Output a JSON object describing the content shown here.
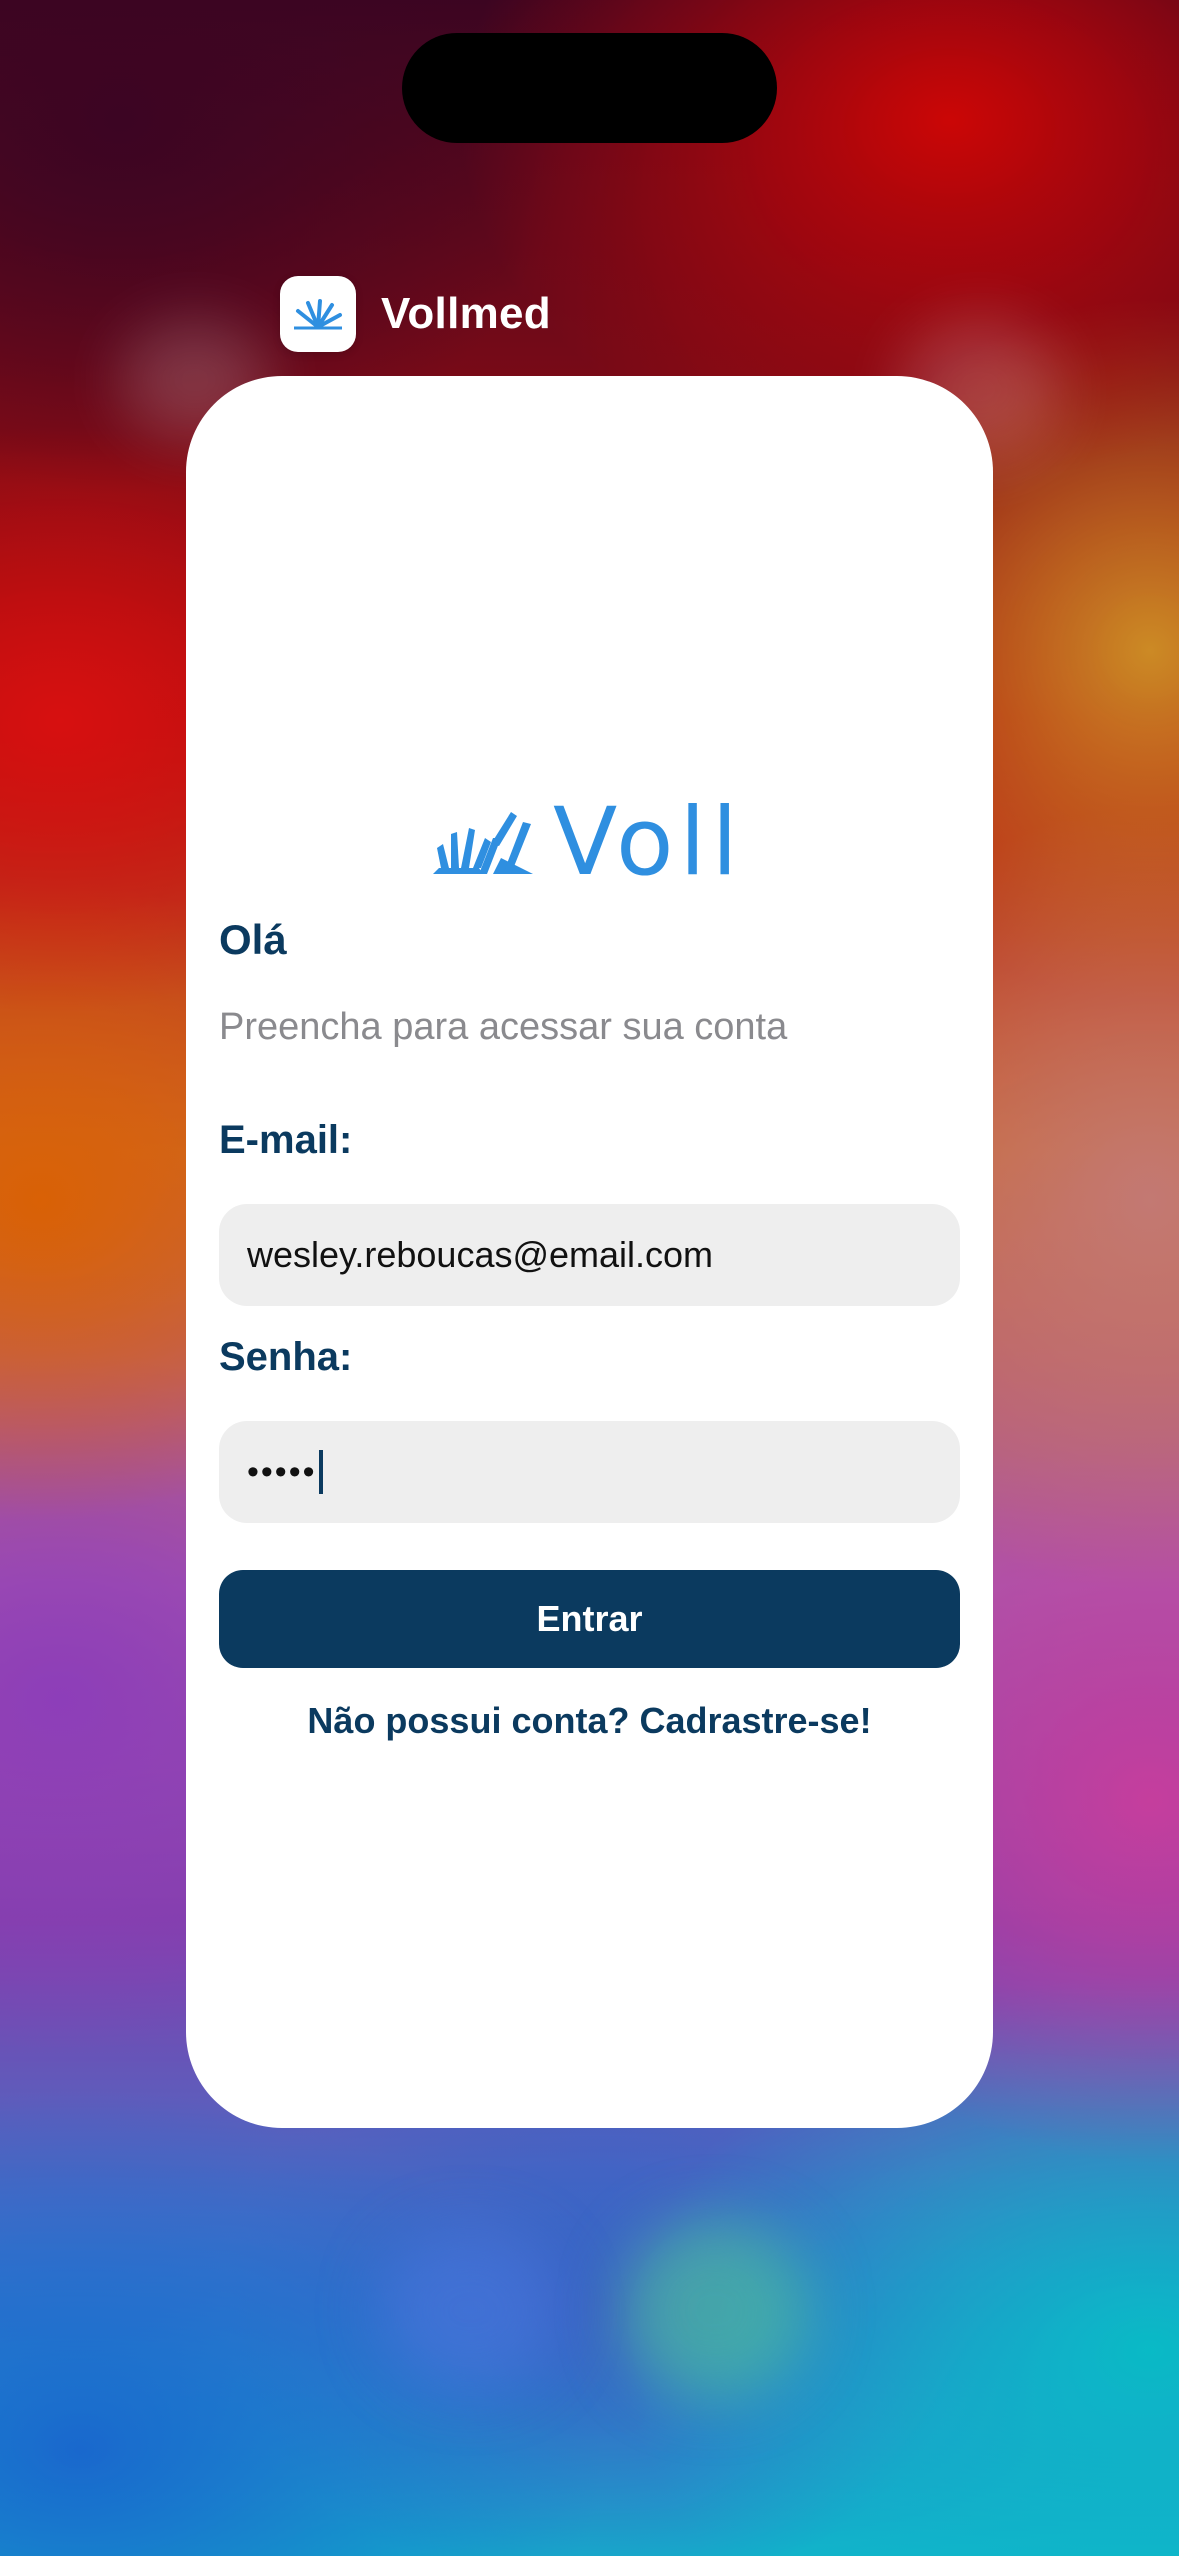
{
  "app": {
    "name": "Vollmed"
  },
  "logo": {
    "text": "Voll",
    "color": "#2f8fe0"
  },
  "login": {
    "greeting": "Olá",
    "subtitle": "Preencha para acessar sua conta",
    "email_label": "E-mail:",
    "email_value": "wesley.reboucas@email.com",
    "password_label": "Senha:",
    "password_value": "•••••",
    "submit_label": "Entrar",
    "signup_link": "Não possui conta? Cadrastre-se!"
  },
  "colors": {
    "primary": "#0b3a5f",
    "accent": "#2f8fe0",
    "input_bg": "#eeeeee",
    "subtitle": "#8a8a8e"
  },
  "icons": {
    "app_icon": "voll-rays-icon"
  }
}
